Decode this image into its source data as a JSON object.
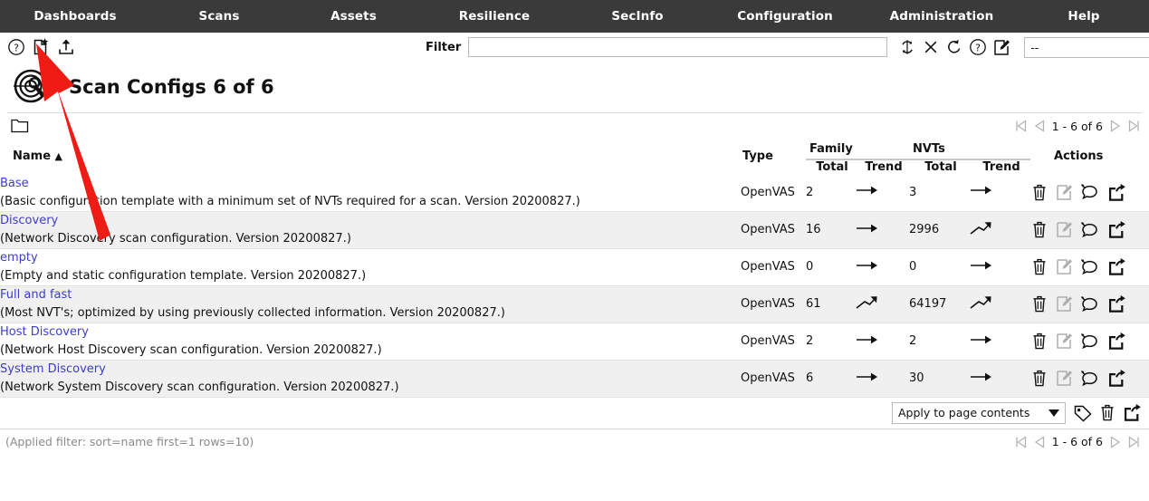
{
  "navbar": {
    "items": [
      {
        "label": "Dashboards",
        "name": "nav-dashboards"
      },
      {
        "label": "Scans",
        "name": "nav-scans"
      },
      {
        "label": "Assets",
        "name": "nav-assets"
      },
      {
        "label": "Resilience",
        "name": "nav-resilience"
      },
      {
        "label": "SecInfo",
        "name": "nav-secinfo"
      },
      {
        "label": "Configuration",
        "name": "nav-configuration"
      },
      {
        "label": "Administration",
        "name": "nav-administration"
      },
      {
        "label": "Help",
        "name": "nav-help"
      }
    ],
    "background": "#3a3a3a",
    "text_color": "#ffffff"
  },
  "toolbar": {
    "icons": [
      {
        "name": "help-icon",
        "title": "Help"
      },
      {
        "name": "new-scan-config-icon",
        "title": "New Scan Config"
      },
      {
        "name": "upload-import-icon",
        "title": "Import Scan Config"
      }
    ]
  },
  "filter": {
    "label": "Filter",
    "value": "",
    "placeholder": "",
    "actions": [
      {
        "name": "refresh-filter-icon",
        "title": "Update Filter"
      },
      {
        "name": "reset-filter-icon",
        "title": "Remove Filter"
      },
      {
        "name": "restore-filter-icon",
        "title": "Reset to Default Filter"
      },
      {
        "name": "filter-help-icon",
        "title": "Help: Powerfilter"
      },
      {
        "name": "edit-filter-icon",
        "title": "Edit Filter"
      }
    ],
    "select_value": "--"
  },
  "page": {
    "title": "Scan Configs 6 of 6",
    "icon": "scan-config-radar-icon"
  },
  "list_header": {
    "folder_icon": "folder-icon",
    "pagination": "1 - 6 of 6"
  },
  "table": {
    "columns": {
      "name": "Name",
      "sort_indicator": "▲",
      "type": "Type",
      "family_group": "Family",
      "nvts_group": "NVTs",
      "family_total": "Total",
      "family_trend": "Trend",
      "nvts_total": "Total",
      "nvts_trend": "Trend",
      "actions": "Actions"
    },
    "row_actions": [
      {
        "name": "delete-icon",
        "title": "Move to Trashcan"
      },
      {
        "name": "edit-icon",
        "title": "Edit Scan Config"
      },
      {
        "name": "clone-icon",
        "title": "Clone Scan Config"
      },
      {
        "name": "export-icon",
        "title": "Export Scan Config"
      }
    ],
    "rows": [
      {
        "name": "Base",
        "description": "(Basic configuration template with a minimum set of NVTs required for a scan. Version 20200827.)",
        "type": "OpenVAS",
        "family_total": "2",
        "family_trend": "same",
        "nvts_total": "3",
        "nvts_trend": "same"
      },
      {
        "name": "Discovery",
        "description": "(Network Discovery scan configuration. Version 20200827.)",
        "type": "OpenVAS",
        "family_total": "16",
        "family_trend": "same",
        "nvts_total": "2996",
        "nvts_trend": "up"
      },
      {
        "name": "empty",
        "description": "(Empty and static configuration template. Version 20200827.)",
        "type": "OpenVAS",
        "family_total": "0",
        "family_trend": "same",
        "nvts_total": "0",
        "nvts_trend": "same"
      },
      {
        "name": "Full and fast",
        "description": "(Most NVT's; optimized by using previously collected information. Version 20200827.)",
        "type": "OpenVAS",
        "family_total": "61",
        "family_trend": "up",
        "nvts_total": "64197",
        "nvts_trend": "up"
      },
      {
        "name": "Host Discovery",
        "description": "(Network Host Discovery scan configuration. Version 20200827.)",
        "type": "OpenVAS",
        "family_total": "2",
        "family_trend": "same",
        "nvts_total": "2",
        "nvts_trend": "same"
      },
      {
        "name": "System Discovery",
        "description": "(Network System Discovery scan configuration. Version 20200827.)",
        "type": "OpenVAS",
        "family_total": "6",
        "family_trend": "same",
        "nvts_total": "30",
        "nvts_trend": "same"
      }
    ]
  },
  "bottom_bar": {
    "apply_select_value": "Apply to page contents",
    "icons": [
      {
        "name": "add-tag-icon",
        "title": "Add Tag"
      },
      {
        "name": "bulk-delete-icon",
        "title": "Move Page Contents to Trashcan"
      },
      {
        "name": "bulk-export-icon",
        "title": "Export Page Contents"
      }
    ]
  },
  "footer": {
    "applied_filter": "(Applied filter: sort=name first=1 rows=10)",
    "pagination": "1 - 6 of 6"
  },
  "annotation": {
    "arrow_color": "#ee1c14",
    "points_to": "new-scan-config-icon"
  }
}
